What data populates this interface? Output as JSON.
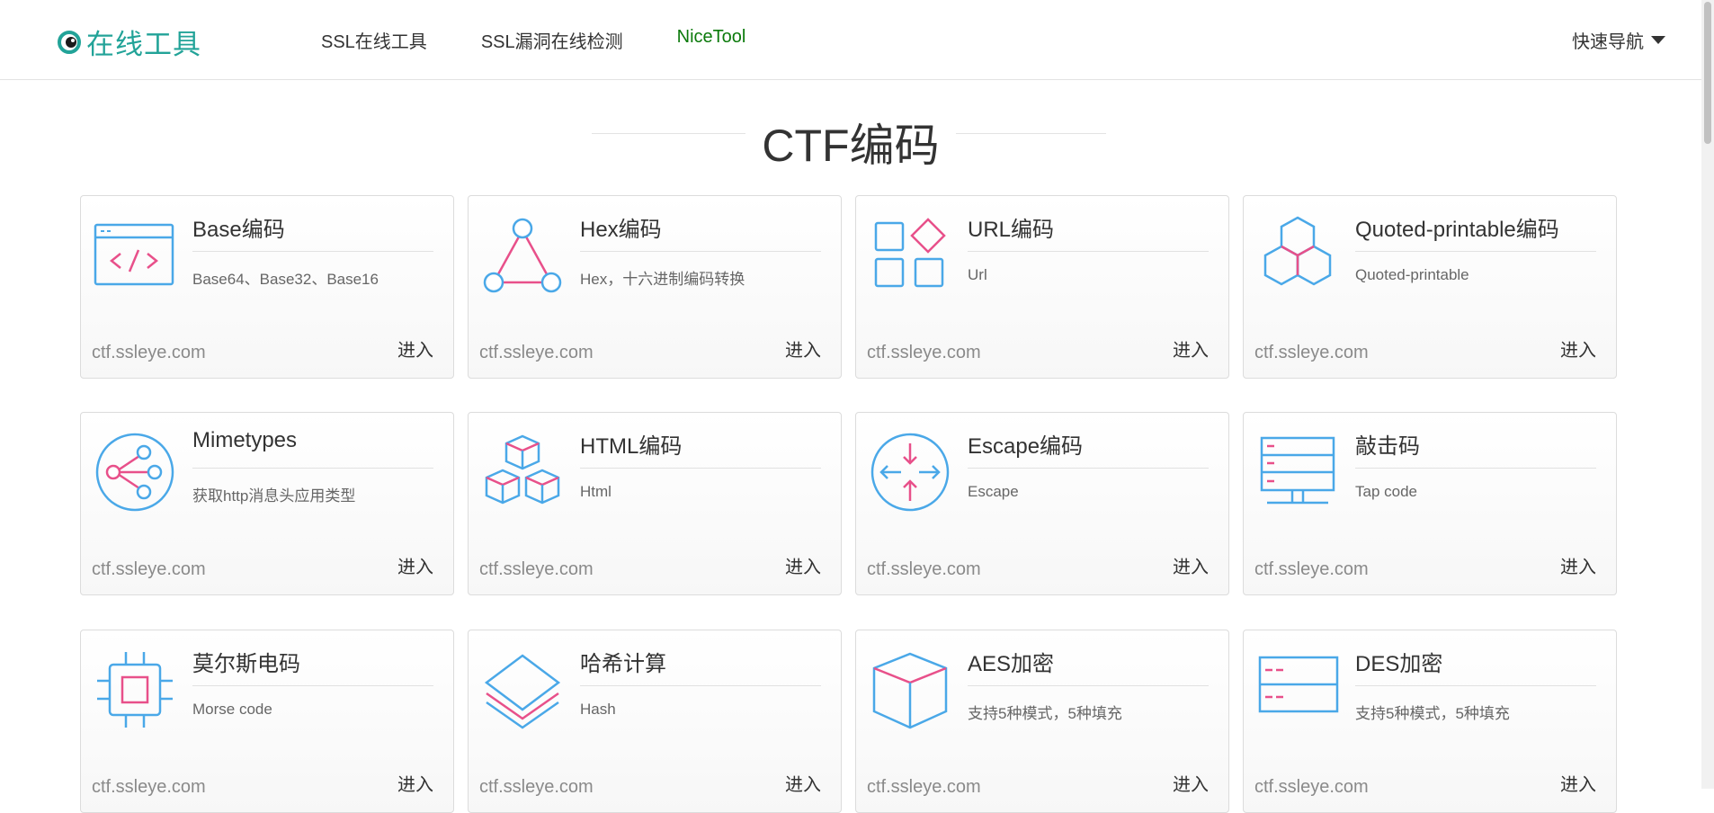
{
  "header": {
    "logo_text": "在线工具",
    "nav": [
      "SSL在线工具",
      "SSL漏洞在线检测",
      "NiceTool"
    ],
    "quick_nav": "快速导航"
  },
  "section": {
    "title": "CTF编码"
  },
  "colors": {
    "brand": "#22a398",
    "icon_blue": "#4aa8e8",
    "icon_pink": "#e8508a",
    "nav_accent": "#0b7a0b"
  },
  "cards": [
    {
      "title": "Base编码",
      "desc": "Base64、Base32、Base16",
      "domain": "ctf.ssleye.com",
      "enter": "进入",
      "icon": "code-window-icon"
    },
    {
      "title": "Hex编码",
      "desc": "Hex，十六进制编码转换",
      "domain": "ctf.ssleye.com",
      "enter": "进入",
      "icon": "triangle-nodes-icon"
    },
    {
      "title": "URL编码",
      "desc": "Url",
      "domain": "ctf.ssleye.com",
      "enter": "进入",
      "icon": "grid-diamond-icon"
    },
    {
      "title": "Quoted-printable编码",
      "desc": "Quoted-printable",
      "domain": "ctf.ssleye.com",
      "enter": "进入",
      "icon": "hexagons-icon"
    },
    {
      "title": "Mimetypes",
      "desc": "获取http消息头应用类型",
      "domain": "ctf.ssleye.com",
      "enter": "进入",
      "icon": "share-icon"
    },
    {
      "title": "HTML编码",
      "desc": "Html",
      "domain": "ctf.ssleye.com",
      "enter": "进入",
      "icon": "cubes-icon"
    },
    {
      "title": "Escape编码",
      "desc": "Escape",
      "domain": "ctf.ssleye.com",
      "enter": "进入",
      "icon": "arrows-in-circle-icon"
    },
    {
      "title": "敲击码",
      "desc": "Tap code",
      "domain": "ctf.ssleye.com",
      "enter": "进入",
      "icon": "server-icon"
    },
    {
      "title": "莫尔斯电码",
      "desc": "Morse code",
      "domain": "ctf.ssleye.com",
      "enter": "进入",
      "icon": "chip-icon"
    },
    {
      "title": "哈希计算",
      "desc": "Hash",
      "domain": "ctf.ssleye.com",
      "enter": "进入",
      "icon": "layers-icon"
    },
    {
      "title": "AES加密",
      "desc": "支持5种模式，5种填充",
      "domain": "ctf.ssleye.com",
      "enter": "进入",
      "icon": "box-icon"
    },
    {
      "title": "DES加密",
      "desc": "支持5种模式，5种填充",
      "domain": "ctf.ssleye.com",
      "enter": "进入",
      "icon": "panel-icon"
    }
  ]
}
